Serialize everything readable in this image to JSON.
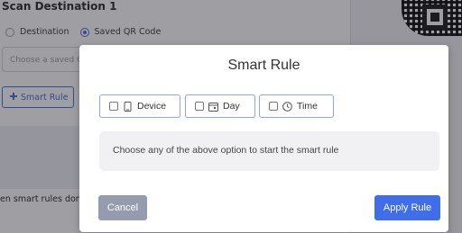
{
  "background": {
    "section_title": "Scan Destination 1",
    "radio_destination": "Destination",
    "radio_saved_qr": "Saved QR Code",
    "select_placeholder": "Choose a saved QR Code",
    "add_rule_label": "Smart Rule",
    "note_text": "en smart rules don"
  },
  "modal": {
    "title": "Smart Rule",
    "options": [
      {
        "label": "Device",
        "icon": "device-icon"
      },
      {
        "label": "Day",
        "icon": "calendar-icon"
      },
      {
        "label": "Time",
        "icon": "clock-icon"
      }
    ],
    "info_text": "Choose any of the above option to start the smart rule",
    "cancel_label": "Cancel",
    "apply_label": "Apply Rule"
  },
  "colors": {
    "primary": "#3f6ee8",
    "cancel": "#959caf",
    "option_border": "#8fa8e0"
  }
}
